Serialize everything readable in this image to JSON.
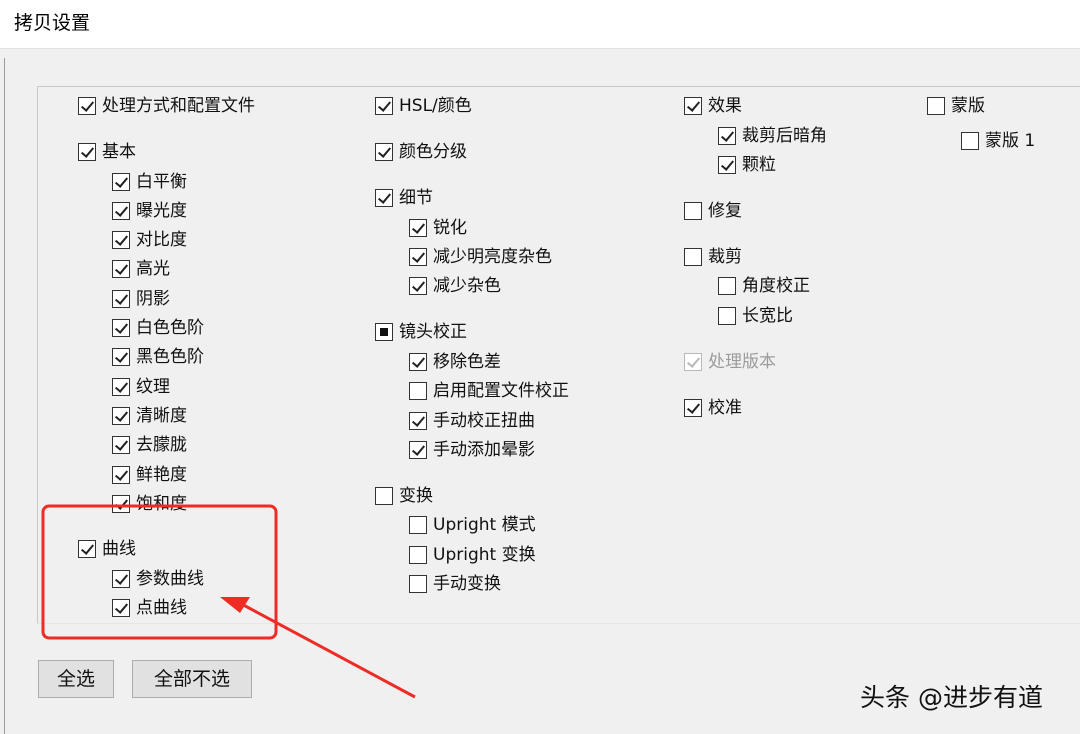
{
  "window": {
    "title": "拷贝设置"
  },
  "col1": {
    "process": {
      "label": "处理方式和配置文件",
      "checked": true
    },
    "basic": {
      "label": "基本",
      "checked": true,
      "items": [
        {
          "label": "白平衡",
          "checked": true
        },
        {
          "label": "曝光度",
          "checked": true
        },
        {
          "label": "对比度",
          "checked": true
        },
        {
          "label": "高光",
          "checked": true
        },
        {
          "label": "阴影",
          "checked": true
        },
        {
          "label": "白色色阶",
          "checked": true
        },
        {
          "label": "黑色色阶",
          "checked": true
        },
        {
          "label": "纹理",
          "checked": true
        },
        {
          "label": "清晰度",
          "checked": true
        },
        {
          "label": "去朦胧",
          "checked": true
        },
        {
          "label": "鲜艳度",
          "checked": true
        },
        {
          "label": "饱和度",
          "checked": true
        }
      ]
    },
    "curves": {
      "label": "曲线",
      "checked": true,
      "items": [
        {
          "label": "参数曲线",
          "checked": true
        },
        {
          "label": "点曲线",
          "checked": true
        }
      ]
    }
  },
  "col2": {
    "hsl": {
      "label": "HSL/颜色",
      "checked": true
    },
    "grading": {
      "label": "颜色分级",
      "checked": true
    },
    "detail": {
      "label": "细节",
      "checked": true,
      "items": [
        {
          "label": "锐化",
          "checked": true
        },
        {
          "label": "减少明亮度杂色",
          "checked": true
        },
        {
          "label": "减少杂色",
          "checked": true
        }
      ]
    },
    "lens": {
      "label": "镜头校正",
      "state": "indeterminate",
      "items": [
        {
          "label": "移除色差",
          "checked": true
        },
        {
          "label": "启用配置文件校正",
          "checked": false
        },
        {
          "label": "手动校正扭曲",
          "checked": true
        },
        {
          "label": "手动添加晕影",
          "checked": true
        }
      ]
    },
    "transform": {
      "label": "变换",
      "checked": false,
      "items": [
        {
          "label": "Upright 模式",
          "checked": false
        },
        {
          "label": "Upright 变换",
          "checked": false
        },
        {
          "label": "手动变换",
          "checked": false
        }
      ]
    }
  },
  "col3": {
    "effects": {
      "label": "效果",
      "checked": true,
      "items": [
        {
          "label": "裁剪后暗角",
          "checked": true
        },
        {
          "label": "颗粒",
          "checked": true
        }
      ]
    },
    "repair": {
      "label": "修复",
      "checked": false
    },
    "crop": {
      "label": "裁剪",
      "checked": false,
      "items": [
        {
          "label": "角度校正",
          "checked": false
        },
        {
          "label": "长宽比",
          "checked": false
        }
      ]
    },
    "process_version": {
      "label": "处理版本",
      "checked": true,
      "disabled": true
    },
    "calibration": {
      "label": "校准",
      "checked": true
    }
  },
  "col4": {
    "masks": {
      "label": "蒙版",
      "checked": false,
      "items": [
        {
          "label": "蒙版 1",
          "checked": false
        }
      ]
    }
  },
  "buttons": {
    "select_all": "全选",
    "select_none": "全部不选"
  },
  "watermark": "头条 @进步有道",
  "colors": {
    "annotation": "#ee2b24",
    "background": "#f0f0f0"
  }
}
